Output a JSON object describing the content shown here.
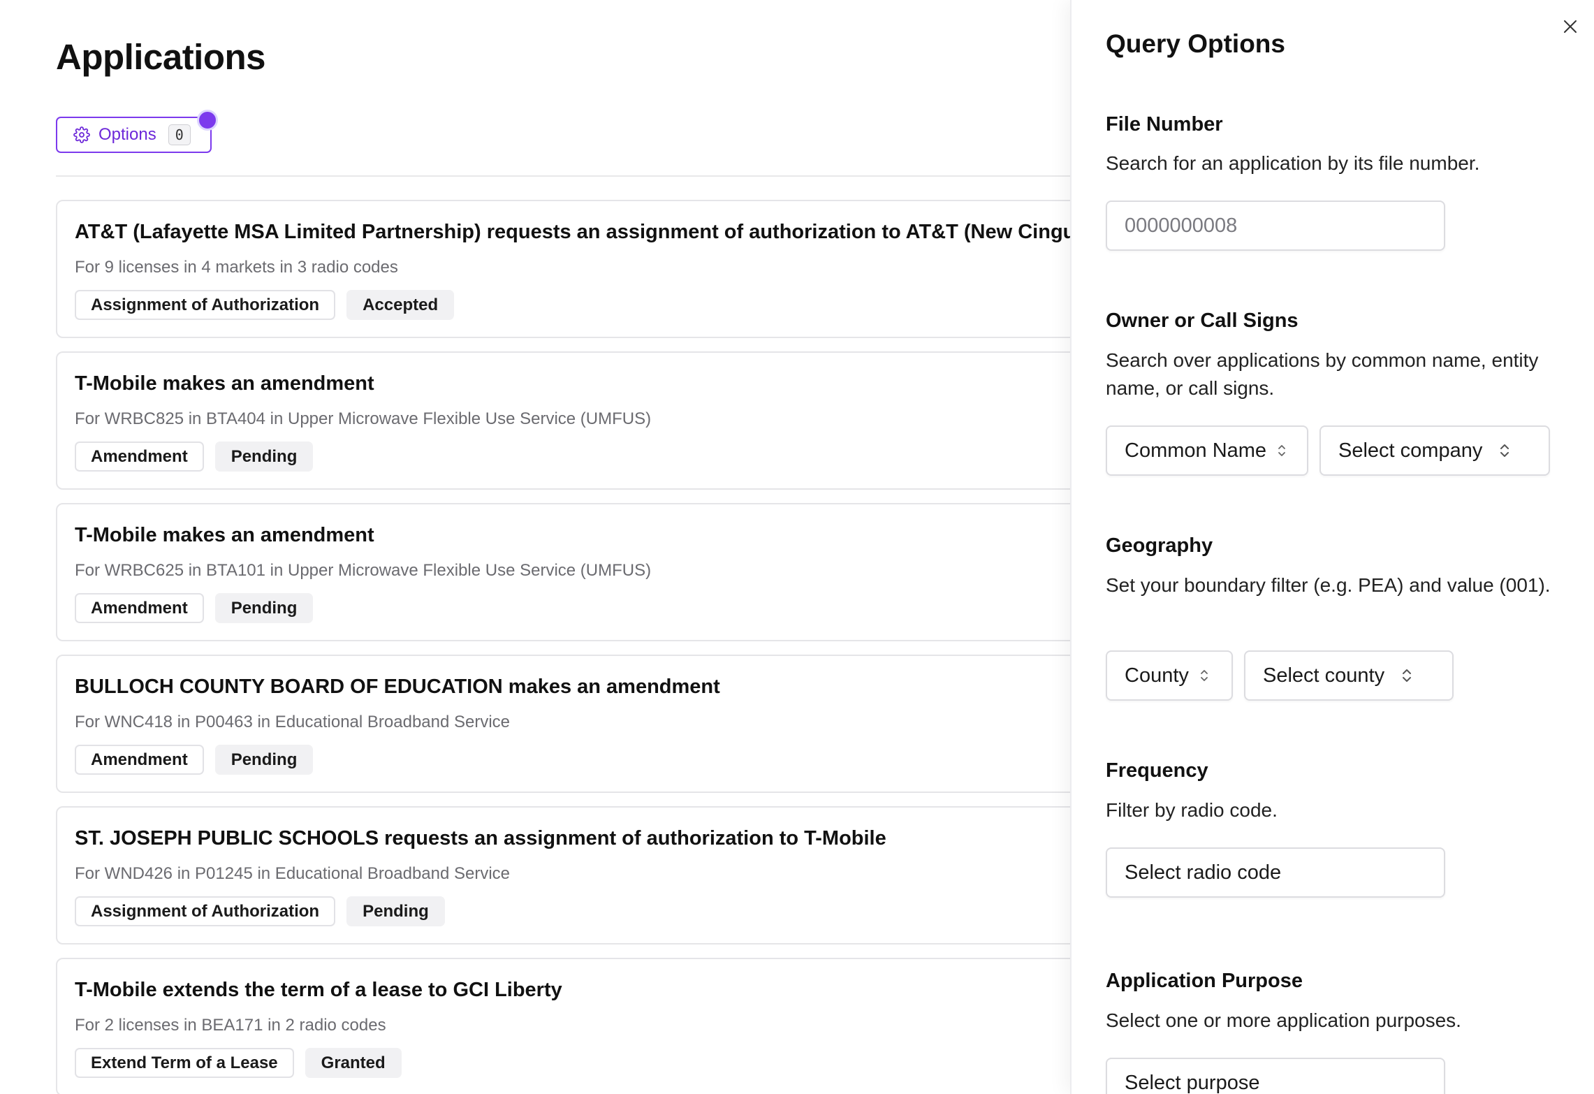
{
  "page": {
    "title": "Applications",
    "options_label": "Options",
    "options_count": "0"
  },
  "applications": [
    {
      "title": "AT&T (Lafayette MSA Limited Partnership) requests an assignment of authorization to AT&T (New Cingular Wireless PCS, LLC)",
      "subtitle": "For 9 licenses in 4 markets in 3 radio codes",
      "type": "Assignment of Authorization",
      "status": "Accepted"
    },
    {
      "title": "T-Mobile makes an amendment",
      "subtitle": "For WRBC825 in BTA404 in Upper Microwave Flexible Use Service (UMFUS)",
      "type": "Amendment",
      "status": "Pending"
    },
    {
      "title": "T-Mobile makes an amendment",
      "subtitle": "For WRBC625 in BTA101 in Upper Microwave Flexible Use Service (UMFUS)",
      "type": "Amendment",
      "status": "Pending"
    },
    {
      "title": "BULLOCH COUNTY BOARD OF EDUCATION makes an amendment",
      "subtitle": "For WNC418 in P00463 in Educational Broadband Service",
      "type": "Amendment",
      "status": "Pending"
    },
    {
      "title": "ST. JOSEPH PUBLIC SCHOOLS requests an assignment of authorization to T-Mobile",
      "subtitle": "For WND426 in P01245 in Educational Broadband Service",
      "type": "Assignment of Authorization",
      "status": "Pending"
    },
    {
      "title": "T-Mobile extends the term of a lease to GCI Liberty",
      "subtitle": "For 2 licenses in BEA171 in 2 radio codes",
      "type": "Extend Term of a Lease",
      "status": "Granted"
    }
  ],
  "panel": {
    "title": "Query Options",
    "file_number": {
      "label": "File Number",
      "description": "Search for an application by its file number.",
      "placeholder": "0000000008"
    },
    "owner": {
      "label": "Owner or Call Signs",
      "description": "Search over applications by common name, entity name, or call signs.",
      "mode": "Common Name",
      "select_placeholder": "Select company"
    },
    "geography": {
      "label": "Geography",
      "description": "Set your boundary filter (e.g. PEA) and value (001).",
      "mode": "County",
      "select_placeholder": "Select county"
    },
    "frequency": {
      "label": "Frequency",
      "description": "Filter by radio code.",
      "select_placeholder": "Select radio code"
    },
    "purpose": {
      "label": "Application Purpose",
      "description": "Select one or more application purposes.",
      "select_placeholder": "Select purpose"
    }
  },
  "colors": {
    "accent": "#7c3aed",
    "border": "#e5e5e8",
    "muted_text": "#6b6b70"
  }
}
